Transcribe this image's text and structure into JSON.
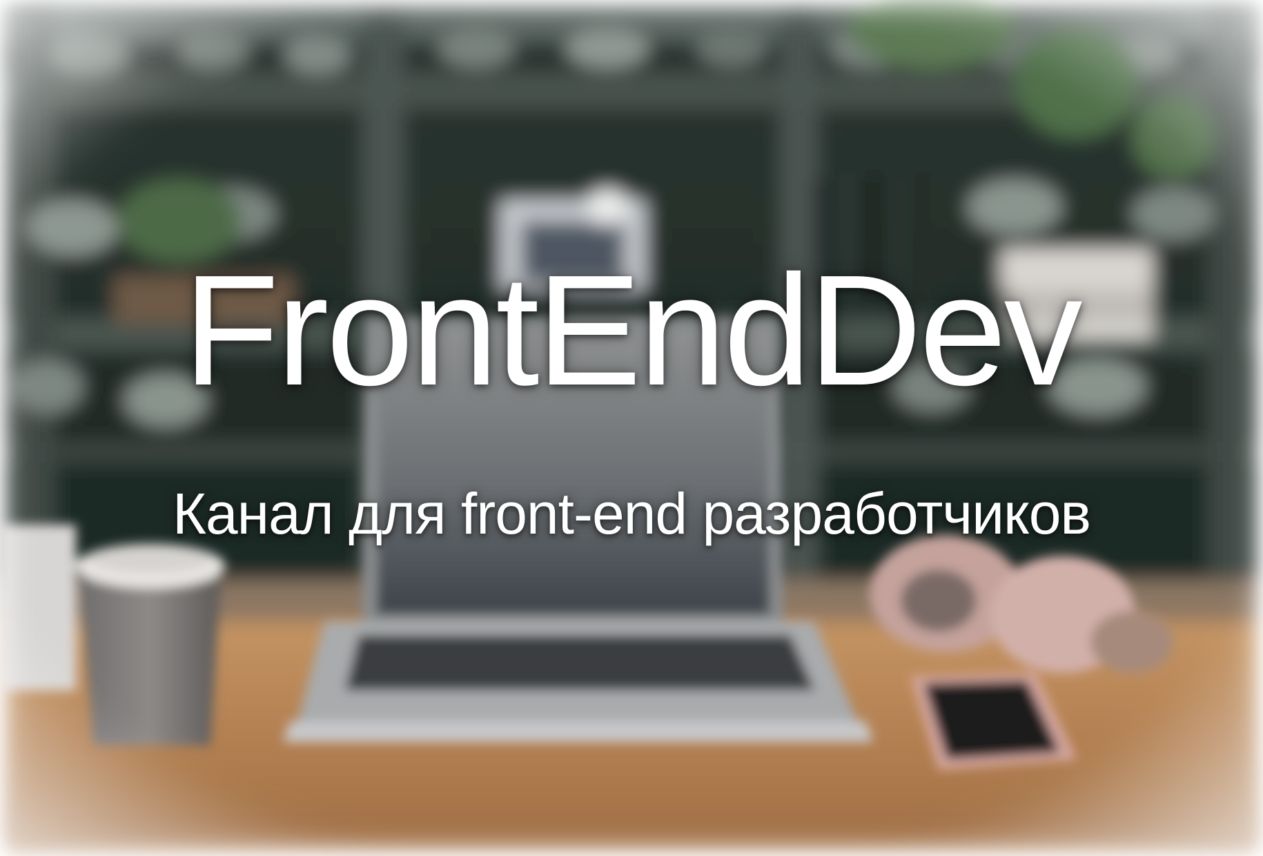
{
  "banner": {
    "title": "FrontEndDev",
    "subtitle": "Канал для front-end разработчиков"
  },
  "colors": {
    "text": "#ffffff",
    "background_dark": "#1f2a26",
    "shelf": "#3e4742",
    "desk": "#b9895a",
    "frame": "#ffffff"
  },
  "scene": {
    "description_icons": [
      "laptop-icon",
      "coffee-cup-icon",
      "smartphone-icon",
      "headphones-icon",
      "plant-icon",
      "books-icon"
    ]
  }
}
